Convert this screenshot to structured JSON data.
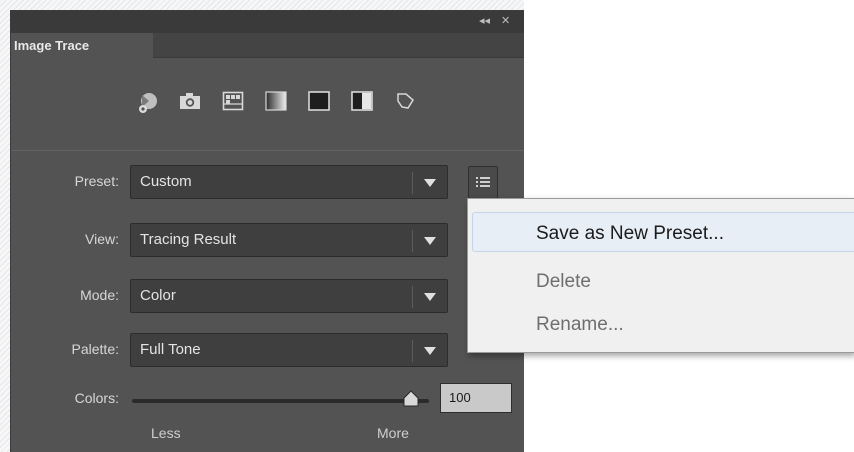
{
  "panel": {
    "title": "Image Trace",
    "titlebar_buttons": {
      "collapse": "◂◂",
      "close": "✕"
    },
    "presets_icons": [
      "auto-color-icon",
      "high-color-icon",
      "low-color-icon",
      "grayscale-icon",
      "black-and-white-icon",
      "outline-icon"
    ],
    "fields": {
      "preset": {
        "label": "Preset:",
        "value": "Custom"
      },
      "view": {
        "label": "View:",
        "value": "Tracing Result"
      },
      "mode": {
        "label": "Mode:",
        "value": "Color"
      },
      "palette": {
        "label": "Palette:",
        "value": "Full Tone"
      }
    },
    "colors": {
      "label": "Colors:",
      "value": "100",
      "level": 1.0,
      "min_label": "Less",
      "max_label": "More"
    }
  },
  "flyout_menu": {
    "items": [
      {
        "label": "Save as New Preset...",
        "enabled": true,
        "highlighted": true
      },
      {
        "label": "Delete",
        "enabled": false
      },
      {
        "label": "Rename...",
        "enabled": false
      }
    ]
  },
  "colors": {
    "panel_bg": "#535353",
    "field_bg": "#3f3f3f",
    "menu_bg": "#f0f0f0",
    "menu_highlight": "#e8eef6"
  }
}
